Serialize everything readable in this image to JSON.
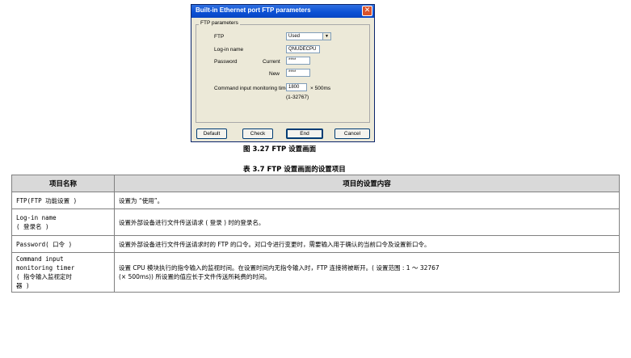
{
  "dialog": {
    "title": "Built-in Ethernet port FTP parameters",
    "close_glyph": "✕",
    "group_label": "FTP parameters",
    "ftp_label": "FTP",
    "ftp_value": "Used",
    "login_label": "Log-in name",
    "login_value": "QNUDECPU",
    "password_label": "Password",
    "current_label": "Current",
    "current_value": "****",
    "new_label": "New",
    "new_value": "****",
    "timer_label": "Command input monitoring timer",
    "timer_value": "1800",
    "timer_unit": "× 500ms",
    "timer_range": "(1-32767)",
    "buttons": {
      "default": "Default",
      "check": "Check",
      "end": "End",
      "cancel": "Cancel"
    }
  },
  "figure_caption": "图 3.27 FTP 设置画面",
  "table_caption": "表 3.7 FTP 设置画面的设置项目",
  "table": {
    "headers": [
      "项目名称",
      "项目的设置内容"
    ],
    "rows": [
      {
        "name_lines": [
          "FTP(FTP 功能设置 )"
        ],
        "content_lines": [
          "设置为 “使用”。"
        ]
      },
      {
        "name_lines": [
          "Log-in name",
          "( 登录名 )"
        ],
        "content_lines": [
          "设置外部设备进行文件传送请求 ( 登录 ) 时的登录名。"
        ]
      },
      {
        "name_lines": [
          "Password( 口令 )"
        ],
        "content_lines": [
          "设置外部设备进行文件传送请求时的 FTP 的口令。对口令进行变更时，需要输入用于确认的当前口令及设置新口令。"
        ]
      },
      {
        "name_lines": [
          "Command input",
          "monitoring timer",
          "( 指令输入监视定时",
          "器 )"
        ],
        "content_lines": [
          "设置 CPU 模块执行的指令输入的监视时间。在设置时间内无指令输入时，FTP 连接将被断开。( 设置范围 : 1 ～ 32767",
          "(× 500ms)) 所设置的值应长于文件传送所耗费的时间。"
        ]
      }
    ]
  }
}
